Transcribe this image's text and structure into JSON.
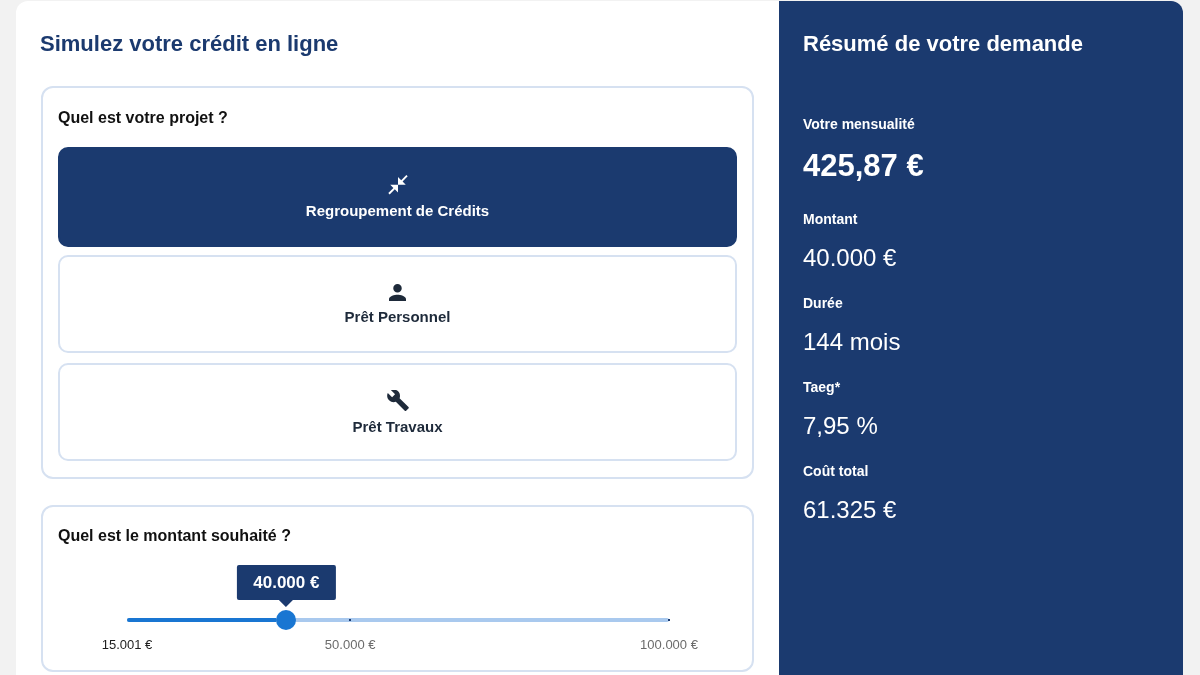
{
  "simulator": {
    "title": "Simulez votre crédit en ligne",
    "project": {
      "question": "Quel est votre projet ?",
      "options": [
        {
          "kind": "consolidation",
          "label": "Regroupement de Crédits",
          "selected": true
        },
        {
          "kind": "personal",
          "label": "Prêt Personnel",
          "selected": false
        },
        {
          "kind": "works",
          "label": "Prêt Travaux",
          "selected": false
        }
      ]
    },
    "amount": {
      "question": "Quel est le montant souhaité ?",
      "slider": {
        "value_label": "40.000 €",
        "level": 0.294,
        "marks": [
          {
            "label": "15.001 €",
            "active": true
          },
          {
            "label": "50.000 €",
            "active": false
          },
          {
            "label": "100.000 €",
            "active": false
          }
        ]
      }
    }
  },
  "summary": {
    "title": "Résumé de votre demande",
    "items": [
      {
        "label": "Votre mensualité",
        "value": "425,87 €",
        "kind": "highlight"
      },
      {
        "label": "Montant",
        "value": "40.000 €",
        "kind": "plain"
      },
      {
        "label": "Durée",
        "value": "144 mois",
        "kind": "plain"
      },
      {
        "label": "Taeg*",
        "value": "7,95 %",
        "kind": "plain"
      },
      {
        "label": "Coût total",
        "value": "61.325 €",
        "kind": "plain"
      }
    ]
  }
}
